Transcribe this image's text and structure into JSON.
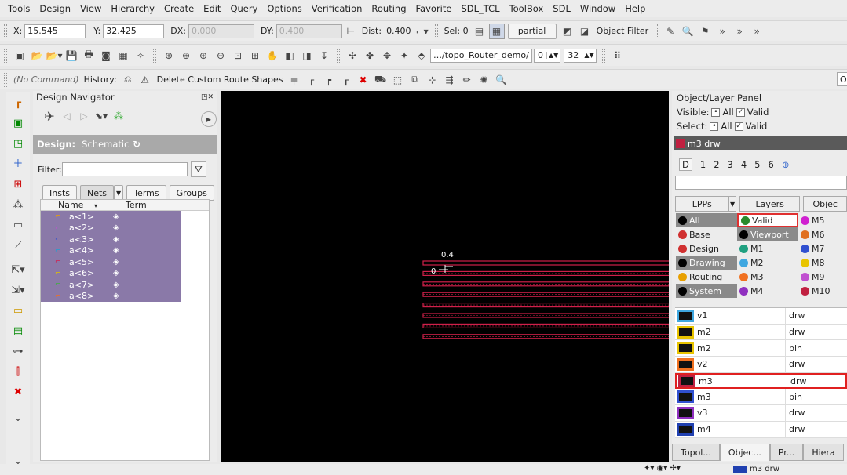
{
  "menu": [
    "Tools",
    "Design",
    "View",
    "Hierarchy",
    "Create",
    "Edit",
    "Query",
    "Options",
    "Verification",
    "Routing",
    "Favorite",
    "SDL_TCL",
    "ToolBox",
    "SDL",
    "Window",
    "Help"
  ],
  "coords": {
    "x_label": "X:",
    "x_value": "15.545",
    "y_label": "Y:",
    "y_value": "32.425",
    "dx_label": "DX:",
    "dx_value": "0.000",
    "dy_label": "DY:",
    "dy_value": "0.400",
    "dist_label": "Dist:",
    "dist_value": "0.400",
    "sel_label": "Sel: 0",
    "partial": "partial",
    "object_filter": "Object Filter"
  },
  "toolbar2": {
    "path": "…/topo_Router_demo/…",
    "spin1": "0",
    "spin2": "32"
  },
  "cmdline": {
    "no_command": "(No Command)",
    "history": "History:",
    "current": "Delete Custom Route Shapes",
    "right_field": "O"
  },
  "navigator": {
    "title": "Design Navigator",
    "design_label": "Design:",
    "design_value": "Schematic",
    "filter_label": "Filter:",
    "tabs": [
      "Insts",
      "Nets",
      "Terms",
      "Groups"
    ],
    "col_name": "Name",
    "col_term": "Term",
    "nets": [
      "a<1>",
      "a<2>",
      "a<3>",
      "a<4>",
      "a<5>",
      "a<6>",
      "a<7>",
      "a<8>"
    ]
  },
  "canvas": {
    "label_top": "0.4",
    "label_left": "0",
    "line_color": "#d0204a",
    "wire_count": 8
  },
  "panel": {
    "title": "Object/Layer Panel",
    "visible_label": "Visible:",
    "select_label": "Select:",
    "all": "All",
    "valid": "Valid",
    "current_layer": "m3 drw",
    "digits": [
      "D",
      "1",
      "2",
      "3",
      "4",
      "5",
      "6"
    ],
    "lpp_tabs": [
      "LPPs",
      "Layers",
      "Objec"
    ],
    "cats": [
      [
        "All",
        "Valid",
        "M5"
      ],
      [
        "Base",
        "Viewport",
        "M6"
      ],
      [
        "Design",
        "M1",
        "M7"
      ],
      [
        "Drawing",
        "M2",
        "M8"
      ],
      [
        "Routing",
        "M3",
        "M9"
      ],
      [
        "System",
        "M4",
        "M10"
      ]
    ],
    "layers": [
      {
        "name": "v1",
        "purpose": "drw",
        "color": "#3fa7e0"
      },
      {
        "name": "m2",
        "purpose": "drw",
        "color": "#e8c400"
      },
      {
        "name": "m2",
        "purpose": "pin",
        "color": "#e8c400"
      },
      {
        "name": "v2",
        "purpose": "drw",
        "color": "#f07020"
      },
      {
        "name": "m3",
        "purpose": "drw",
        "color": "#c02040"
      },
      {
        "name": "m3",
        "purpose": "pin",
        "color": "#3050d0"
      },
      {
        "name": "v3",
        "purpose": "drw",
        "color": "#9030c0"
      },
      {
        "name": "m4",
        "purpose": "drw",
        "color": "#2040b0"
      }
    ],
    "bottom_tabs": [
      "Topol...",
      "Objec...",
      "Pr...",
      "Hiera"
    ]
  },
  "status": {
    "layer": "m3 drw"
  }
}
